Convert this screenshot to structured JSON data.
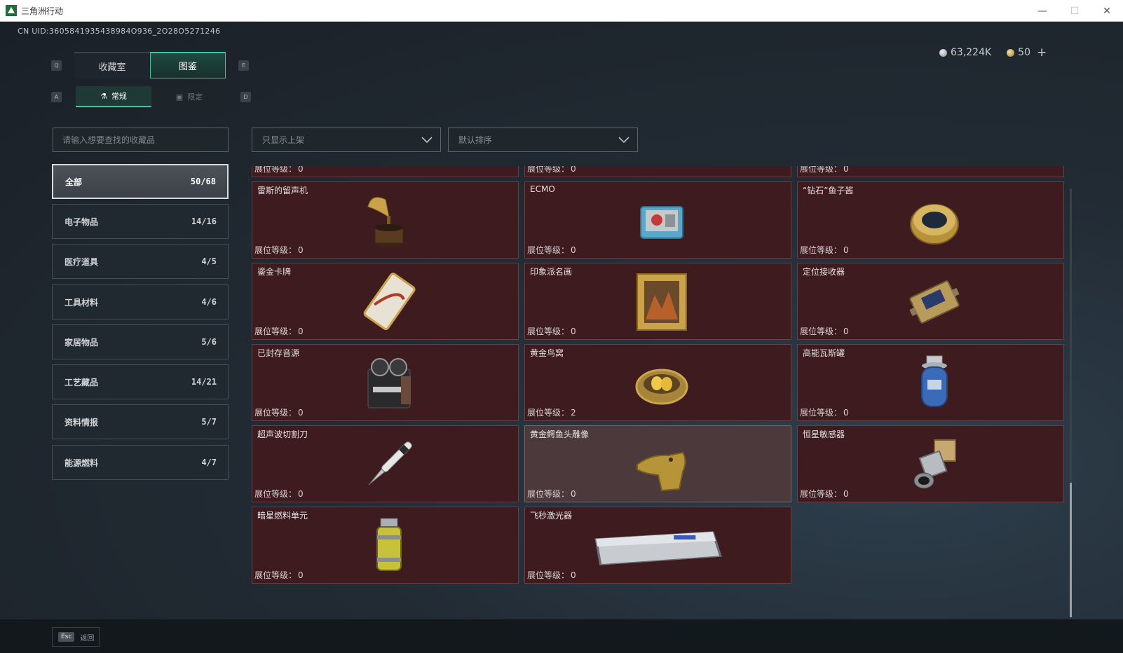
{
  "window": {
    "title": "三角洲行动",
    "minimize": "—",
    "maximize": "☐",
    "close": "✕"
  },
  "uid": "CN UID:3605841935438984O936_2O28O5271246",
  "currency": {
    "coins": "63,224K",
    "premium": "50",
    "plus": "+"
  },
  "hotkeys": {
    "prev_tab": "Q",
    "next_tab": "E",
    "prev_sub": "A",
    "next_sub": "D"
  },
  "tabs": [
    {
      "label": "收藏室"
    },
    {
      "label": "图鉴"
    }
  ],
  "subtabs": [
    {
      "label": "常规",
      "icon": "flask-icon"
    },
    {
      "label": "限定",
      "icon": "image-icon"
    }
  ],
  "search": {
    "placeholder": "请输入想要查找的收藏品"
  },
  "filters": {
    "shelf": "只显示上架",
    "sort": "默认排序"
  },
  "categories": [
    {
      "label": "全部",
      "count": "50/68"
    },
    {
      "label": "电子物品",
      "count": "14/16"
    },
    {
      "label": "医疗道具",
      "count": "4/5"
    },
    {
      "label": "工具材料",
      "count": "4/6"
    },
    {
      "label": "家居物品",
      "count": "5/6"
    },
    {
      "label": "工艺藏品",
      "count": "14/21"
    },
    {
      "label": "资料情报",
      "count": "5/7"
    },
    {
      "label": "能源燃料",
      "count": "4/7"
    }
  ],
  "level_label": "展位等级：",
  "partial_row": [
    {
      "level": "0"
    },
    {
      "level": "0"
    },
    {
      "level": "0"
    }
  ],
  "items": [
    {
      "name": "雷斯的留声机",
      "level": "0",
      "icon": "gramophone-icon"
    },
    {
      "name": "ECMO",
      "level": "0",
      "icon": "ecmo-machine-icon"
    },
    {
      "name": "“钻石”鱼子酱",
      "level": "0",
      "icon": "caviar-tin-icon"
    },
    {
      "name": "鎏金卡牌",
      "level": "0",
      "icon": "gilded-card-icon"
    },
    {
      "name": "印象派名画",
      "level": "0",
      "icon": "framed-painting-icon"
    },
    {
      "name": "定位接收器",
      "level": "0",
      "icon": "gps-receiver-icon"
    },
    {
      "name": "已封存音源",
      "level": "0",
      "icon": "reel-recorder-icon"
    },
    {
      "name": "黄金鸟窝",
      "level": "2",
      "icon": "golden-nest-icon"
    },
    {
      "name": "高能瓦斯罐",
      "level": "0",
      "icon": "gas-canister-icon"
    },
    {
      "name": "超声波切割刀",
      "level": "0",
      "icon": "ultrasonic-cutter-icon"
    },
    {
      "name": "黄金鳄鱼头雕像",
      "level": "0",
      "icon": "golden-croc-statue-icon"
    },
    {
      "name": "恒星敏感器",
      "level": "0",
      "icon": "star-sensor-icon"
    },
    {
      "name": "暗星燃料单元",
      "level": "0",
      "icon": "fuel-cell-icon"
    },
    {
      "name": "飞秒激光器",
      "level": "0",
      "icon": "femtosecond-laser-icon"
    }
  ],
  "footer": {
    "esc_key": "Esc",
    "back": "返回"
  }
}
